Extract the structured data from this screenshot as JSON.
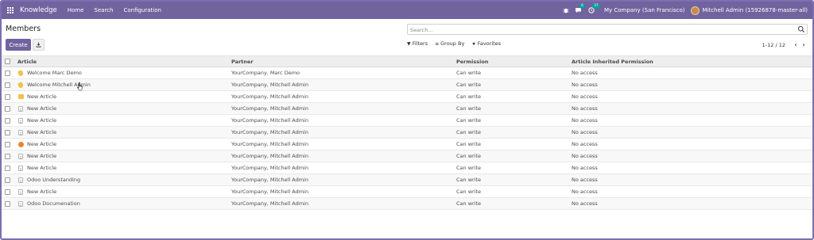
{
  "navbar": {
    "app_name": "Knowledge",
    "menu": [
      "Home",
      "Search",
      "Configuration"
    ],
    "icons": [
      "apps-grid-icon",
      "bug-icon",
      "chat-icon",
      "clock-icon"
    ],
    "messages_badge": "6",
    "activities_badge": "37",
    "company": "My Company (San Francisco)",
    "user": "Mitchell Admin (15926878-master-all)",
    "bg_color": "#71639e"
  },
  "control_panel": {
    "title": "Members",
    "create_label": "Create",
    "search_placeholder": "Search...",
    "filters_label": "Filters",
    "group_by_label": "Group By",
    "favorites_label": "Favorites",
    "pager_value": "1-12 / 12"
  },
  "table": {
    "columns": {
      "article": "Article",
      "partner": "Partner",
      "permission": "Permission",
      "inherited": "Article Inherited Permission"
    },
    "rows": [
      {
        "icon": "hand",
        "article": "Welcome Marc Demo",
        "partner": "YourCompany, Marc Demo",
        "permission": "Can write",
        "inherited": "No access"
      },
      {
        "icon": "hand",
        "article": "Welcome Mitchell Admin",
        "partner": "YourCompany, Mitchell Admin",
        "permission": "Can write",
        "inherited": "No access"
      },
      {
        "icon": "crown",
        "article": "New Article",
        "partner": "YourCompany, Mitchell Admin",
        "permission": "Can write",
        "inherited": "No access"
      },
      {
        "icon": "doc",
        "article": "New Article",
        "partner": "YourCompany, Mitchell Admin",
        "permission": "Can write",
        "inherited": "No access"
      },
      {
        "icon": "doc",
        "article": "New Article",
        "partner": "YourCompany, Mitchell Admin",
        "permission": "Can write",
        "inherited": "No access"
      },
      {
        "icon": "doc",
        "article": "New Article",
        "partner": "YourCompany, Mitchell Admin",
        "permission": "Can write",
        "inherited": "No access"
      },
      {
        "icon": "smiley",
        "article": "New Article",
        "partner": "YourCompany, Mitchell Admin",
        "permission": "Can write",
        "inherited": "No access"
      },
      {
        "icon": "doc",
        "article": "New Article",
        "partner": "YourCompany, Mitchell Admin",
        "permission": "Can write",
        "inherited": "No access"
      },
      {
        "icon": "doc",
        "article": "New Article",
        "partner": "YourCompany, Mitchell Admin",
        "permission": "Can write",
        "inherited": "No access"
      },
      {
        "icon": "doc",
        "article": "Odoo Understanding",
        "partner": "YourCompany, Mitchell Admin",
        "permission": "Can write",
        "inherited": "No access"
      },
      {
        "icon": "doc",
        "article": "New Article",
        "partner": "YourCompany, Mitchell Admin",
        "permission": "Can write",
        "inherited": "No access"
      },
      {
        "icon": "doc",
        "article": "Odoo Documenation",
        "partner": "YourCompany, Mitchell Admin",
        "permission": "Can write",
        "inherited": "No access"
      }
    ]
  }
}
